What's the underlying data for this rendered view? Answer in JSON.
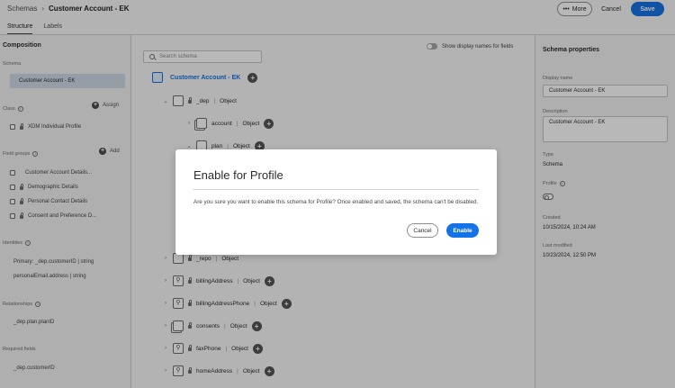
{
  "header": {
    "breadcrumb_root": "Schemas",
    "breadcrumb_current": "Customer Account - EK",
    "more_label": "More",
    "cancel_label": "Cancel",
    "save_label": "Save"
  },
  "tabs": [
    {
      "label": "Structure",
      "active": true
    },
    {
      "label": "Labels",
      "active": false
    }
  ],
  "left": {
    "title": "Composition",
    "schema_label": "Schema",
    "schema_value": "Customer Account - EK",
    "class_label": "Class",
    "assign_label": "Assign",
    "class_value": "XDM Individual Profile",
    "field_groups_label": "Field groups",
    "add_label": "Add",
    "field_groups": [
      "Customer Account Details...",
      "Demographic Details",
      "Personal Contact Details",
      "Consent and Preference D..."
    ],
    "identities_label": "Identities",
    "identities": [
      "Primary: _dep.customerID | string",
      "personalEmail.address | string"
    ],
    "relationships_label": "Relationships",
    "relationships": [
      "_dep.plan.planID"
    ],
    "required_label": "Required fields",
    "required": [
      "_dep.customerID"
    ]
  },
  "center": {
    "search_placeholder": "Search schema",
    "toggle_label": "Show display names for fields",
    "root_name": "Customer Account - EK",
    "nodes": [
      {
        "name": "_dep",
        "type": "Object"
      },
      {
        "name": "account",
        "type": "Object"
      },
      {
        "name": "plan",
        "type": "Object"
      },
      {
        "name": "_repo",
        "type": "Object"
      },
      {
        "name": "billingAddress",
        "type": "Object"
      },
      {
        "name": "billingAddressPhone",
        "type": "Object"
      },
      {
        "name": "consents",
        "type": "Object"
      },
      {
        "name": "faxPhone",
        "type": "Object"
      },
      {
        "name": "homeAddress",
        "type": "Object"
      }
    ]
  },
  "right": {
    "title": "Schema properties",
    "display_name_label": "Display name",
    "display_name_value": "Customer Account - EK",
    "description_label": "Description",
    "description_value": "Customer Account - EK",
    "type_label": "Type",
    "type_value": "Schema",
    "profile_label": "Profile",
    "created_label": "Created",
    "created_value": "10/15/2024, 10:24 AM",
    "modified_label": "Last modified",
    "modified_value": "10/23/2024, 12:50 PM"
  },
  "modal": {
    "title": "Enable for Profile",
    "body": "Are you sure you want to enable this schema for Profile? Once enabled and saved, the schema can't be disabled.",
    "cancel_label": "Cancel",
    "enable_label": "Enable"
  },
  "colors": {
    "accent": "#1473e6",
    "overlay": "rgba(0,0,0,0.28)"
  }
}
